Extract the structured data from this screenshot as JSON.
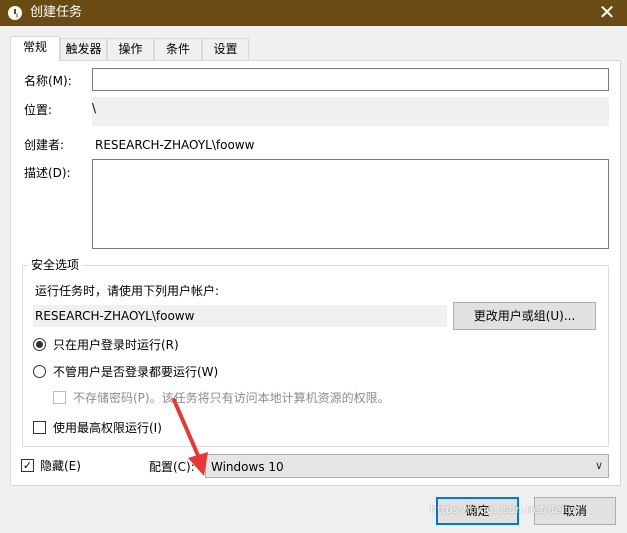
{
  "window": {
    "title": "创建任务",
    "close_glyph": "✕"
  },
  "tabs": [
    "常规",
    "触发器",
    "操作",
    "条件",
    "设置"
  ],
  "general": {
    "name_label": "名称(M):",
    "name_value": "",
    "location_label": "位置:",
    "location_value": "\\",
    "author_label": "创建者:",
    "author_value": "RESEARCH-ZHAOYL\\fooww",
    "description_label": "描述(D):",
    "description_value": ""
  },
  "security": {
    "title": "安全选项",
    "run_as_prompt": "运行任务时，请使用下列用户帐户:",
    "user_account": "RESEARCH-ZHAOYL\\fooww",
    "change_user_button": "更改用户或组(U)...",
    "radio_logged_on": "只在用户登录时运行(R)",
    "radio_logged_on_checked": true,
    "radio_whether": "不管用户是否登录都要运行(W)",
    "radio_whether_checked": false,
    "no_store_password": "不存储密码(P)。该任务将只有访问本地计算机资源的权限。",
    "highest_privileges": "使用最高权限运行(I)"
  },
  "bottom": {
    "hidden_label": "隐藏(E)",
    "hidden_checked": true,
    "configure_label": "配置(C):",
    "configure_value": "Windows 10",
    "ok_button": "确定",
    "cancel_button": "取消"
  },
  "watermark": "https://blog.csdn.net/delta",
  "colors": {
    "titlebar": "#6b4b14",
    "accent": "#0078d7",
    "annotation_arrow": "#e53935"
  }
}
